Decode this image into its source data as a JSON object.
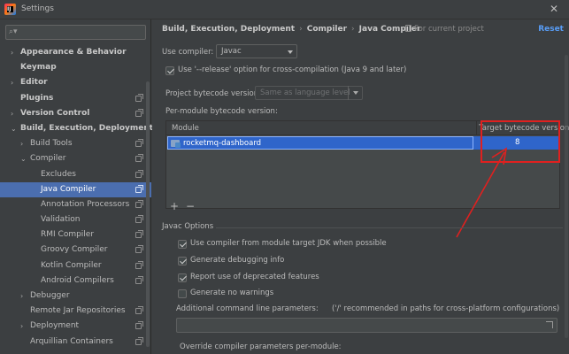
{
  "window": {
    "title": "Settings",
    "app_icon_text": "IJ"
  },
  "sidebar": {
    "search_placeholder": "",
    "items": [
      {
        "label": "Appearance & Behavior",
        "level": 0,
        "arrow": "›",
        "bold": true,
        "gear": false,
        "selected": false
      },
      {
        "label": "Keymap",
        "level": 0,
        "arrow": "",
        "bold": true,
        "gear": false,
        "selected": false
      },
      {
        "label": "Editor",
        "level": 0,
        "arrow": "›",
        "bold": true,
        "gear": false,
        "selected": false
      },
      {
        "label": "Plugins",
        "level": 0,
        "arrow": "",
        "bold": true,
        "gear": true,
        "selected": false
      },
      {
        "label": "Version Control",
        "level": 0,
        "arrow": "›",
        "bold": true,
        "gear": true,
        "selected": false
      },
      {
        "label": "Build, Execution, Deployment",
        "level": 0,
        "arrow": "⌄",
        "bold": true,
        "gear": false,
        "selected": false
      },
      {
        "label": "Build Tools",
        "level": 1,
        "arrow": "›",
        "bold": false,
        "gear": true,
        "selected": false
      },
      {
        "label": "Compiler",
        "level": 1,
        "arrow": "⌄",
        "bold": false,
        "gear": true,
        "selected": false
      },
      {
        "label": "Excludes",
        "level": 2,
        "arrow": "",
        "bold": false,
        "gear": true,
        "selected": false
      },
      {
        "label": "Java Compiler",
        "level": 2,
        "arrow": "",
        "bold": false,
        "gear": true,
        "selected": true
      },
      {
        "label": "Annotation Processors",
        "level": 2,
        "arrow": "",
        "bold": false,
        "gear": true,
        "selected": false
      },
      {
        "label": "Validation",
        "level": 2,
        "arrow": "",
        "bold": false,
        "gear": true,
        "selected": false
      },
      {
        "label": "RMI Compiler",
        "level": 2,
        "arrow": "",
        "bold": false,
        "gear": true,
        "selected": false
      },
      {
        "label": "Groovy Compiler",
        "level": 2,
        "arrow": "",
        "bold": false,
        "gear": true,
        "selected": false
      },
      {
        "label": "Kotlin Compiler",
        "level": 2,
        "arrow": "",
        "bold": false,
        "gear": true,
        "selected": false
      },
      {
        "label": "Android Compilers",
        "level": 2,
        "arrow": "",
        "bold": false,
        "gear": true,
        "selected": false
      },
      {
        "label": "Debugger",
        "level": 1,
        "arrow": "›",
        "bold": false,
        "gear": false,
        "selected": false
      },
      {
        "label": "Remote Jar Repositories",
        "level": 1,
        "arrow": "",
        "bold": false,
        "gear": true,
        "selected": false
      },
      {
        "label": "Deployment",
        "level": 1,
        "arrow": "›",
        "bold": false,
        "gear": true,
        "selected": false
      },
      {
        "label": "Arquillian Containers",
        "level": 1,
        "arrow": "",
        "bold": false,
        "gear": true,
        "selected": false
      }
    ]
  },
  "breadcrumb": {
    "part1": "Build, Execution, Deployment",
    "part2": "Compiler",
    "part3": "Java Compiler",
    "separator": "›"
  },
  "header": {
    "for_project": "For current project",
    "reset": "Reset"
  },
  "form": {
    "use_compiler_label": "Use compiler:",
    "use_compiler_value": "Javac",
    "release_option_label": "Use '--release' option for cross-compilation (Java 9 and later)",
    "project_bytecode_label": "Project bytecode version:",
    "project_bytecode_value": "Same as language level",
    "per_module_label": "Per-module bytecode version:"
  },
  "table": {
    "col_module": "Module",
    "col_target": "Target bytecode version",
    "rows": [
      {
        "module": "rocketmq-dashboard",
        "version": "8"
      }
    ],
    "add": "+",
    "remove": "−"
  },
  "javac": {
    "section_title": "Javac Options",
    "options": [
      {
        "label": "Use compiler from module target JDK when possible",
        "checked": true
      },
      {
        "label": "Generate debugging info",
        "checked": true
      },
      {
        "label": "Report use of deprecated features",
        "checked": true
      },
      {
        "label": "Generate no warnings",
        "checked": false
      }
    ],
    "additional_label": "Additional command line parameters:",
    "additional_hint": "('/' recommended in paths for cross-platform configurations)",
    "additional_value": "",
    "override_label": "Override compiler parameters per-module:"
  },
  "colors": {
    "selection": "#4b6eaf",
    "row_selection": "#2f65ca",
    "link": "#589df6",
    "annotation": "#e0201f"
  }
}
